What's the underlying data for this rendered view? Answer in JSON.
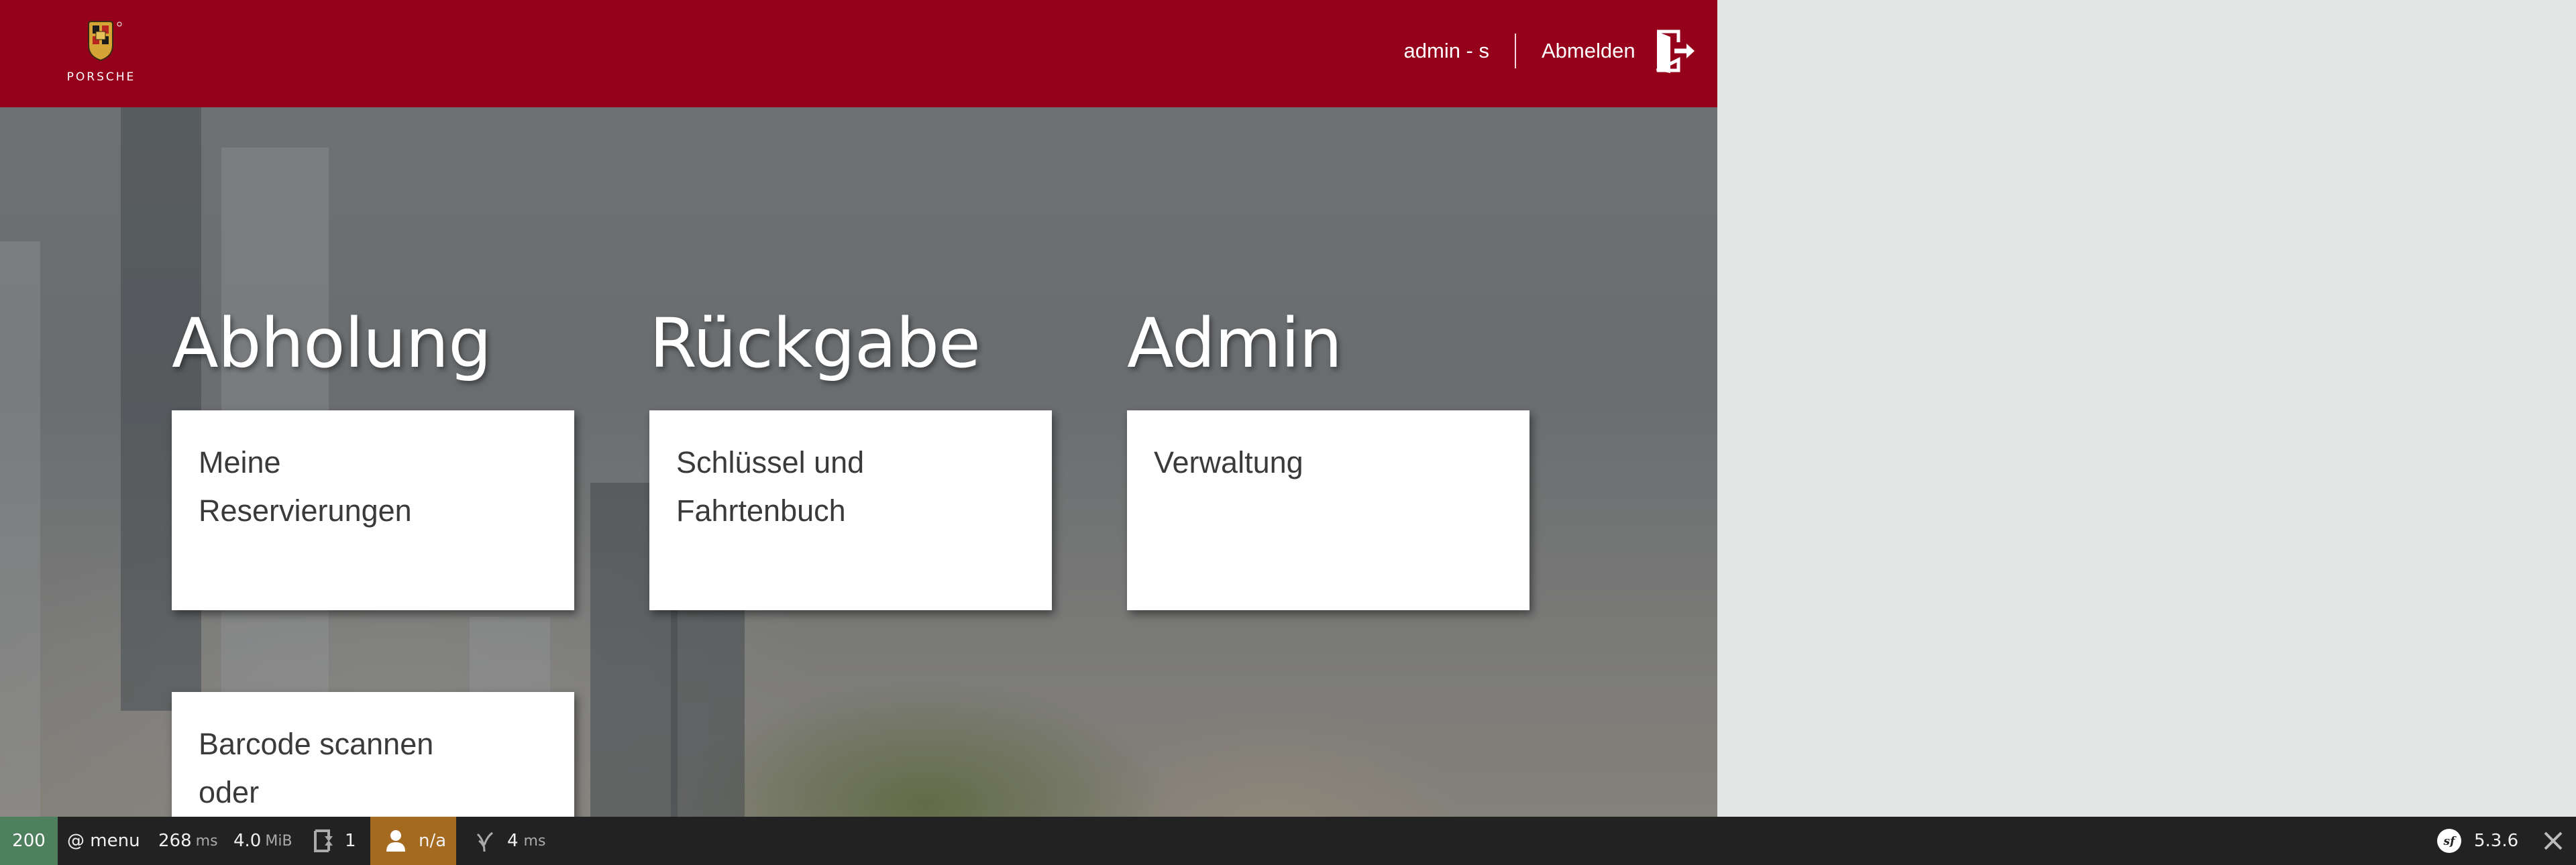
{
  "header": {
    "logo_text": "PORSCHE",
    "user": "admin - s",
    "logout_label": "Abmelden"
  },
  "sections": [
    {
      "title": "Abholung",
      "cards": [
        {
          "label": "Meine\nReservierungen"
        },
        {
          "label": "Barcode scannen\noder"
        }
      ]
    },
    {
      "title": "Rückgabe",
      "cards": [
        {
          "label": "Schlüssel und\nFahrtenbuch"
        }
      ]
    },
    {
      "title": "Admin",
      "cards": [
        {
          "label": "Verwaltung"
        }
      ]
    }
  ],
  "toolbar": {
    "status_code": "200",
    "route": "@ menu",
    "time_value": "268",
    "time_unit": "ms",
    "memory_value": "4.0",
    "memory_unit": "MiB",
    "requests": "1",
    "user": "n/a",
    "twig_value": "4",
    "twig_unit": "ms",
    "version": "5.3.6"
  },
  "colors": {
    "header_bg": "#95001a",
    "side_bg": "#e3e5e4",
    "status_ok": "#4f805d",
    "user_warn": "#a46a1f"
  }
}
